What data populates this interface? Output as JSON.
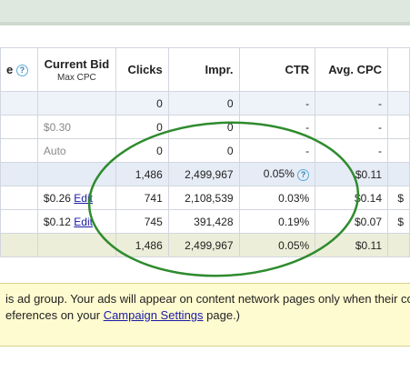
{
  "header": {
    "col0": "e",
    "col1": "Current Bid",
    "col1_sub": "Max CPC",
    "col2": "Clicks",
    "col3": "Impr.",
    "col4": "CTR",
    "col5": "Avg. CPC",
    "help_glyph": "?"
  },
  "rows": [
    {
      "type": "lblue",
      "bid": "",
      "edit": "",
      "clicks": "0",
      "impr": "0",
      "ctr": "-",
      "avg": "-",
      "extra": ""
    },
    {
      "type": "white",
      "bid": "$0.30",
      "edit": "",
      "clicks": "0",
      "impr": "0",
      "ctr": "-",
      "avg": "-",
      "extra": ""
    },
    {
      "type": "white",
      "bid": "Auto",
      "edit": "",
      "clicks": "0",
      "impr": "0",
      "ctr": "-",
      "avg": "-",
      "extra": ""
    },
    {
      "type": "blue",
      "bid": "",
      "edit": "",
      "clicks": "1,486",
      "impr": "2,499,967",
      "ctr": "0.05%",
      "avg": "$0.11",
      "extra": ""
    },
    {
      "type": "white",
      "bid": "$0.26",
      "edit": "Edit",
      "clicks": "741",
      "impr": "2,108,539",
      "ctr": "0.03%",
      "avg": "$0.14",
      "extra": "$"
    },
    {
      "type": "white",
      "bid": "$0.12",
      "edit": "Edit",
      "clicks": "745",
      "impr": "391,428",
      "ctr": "0.19%",
      "avg": "$0.07",
      "extra": "$"
    },
    {
      "type": "total",
      "bid": "",
      "edit": "",
      "clicks": "1,486",
      "impr": "2,499,967",
      "ctr": "0.05%",
      "avg": "$0.11",
      "extra": ""
    }
  ],
  "notice": {
    "line1": "is ad group. Your ads will appear on content network pages only when their co",
    "line2_pre": "eferences on your ",
    "line2_link": "Campaign Settings",
    "line2_post": " page.)"
  },
  "annotation": {
    "color": "#2e8b2e"
  }
}
